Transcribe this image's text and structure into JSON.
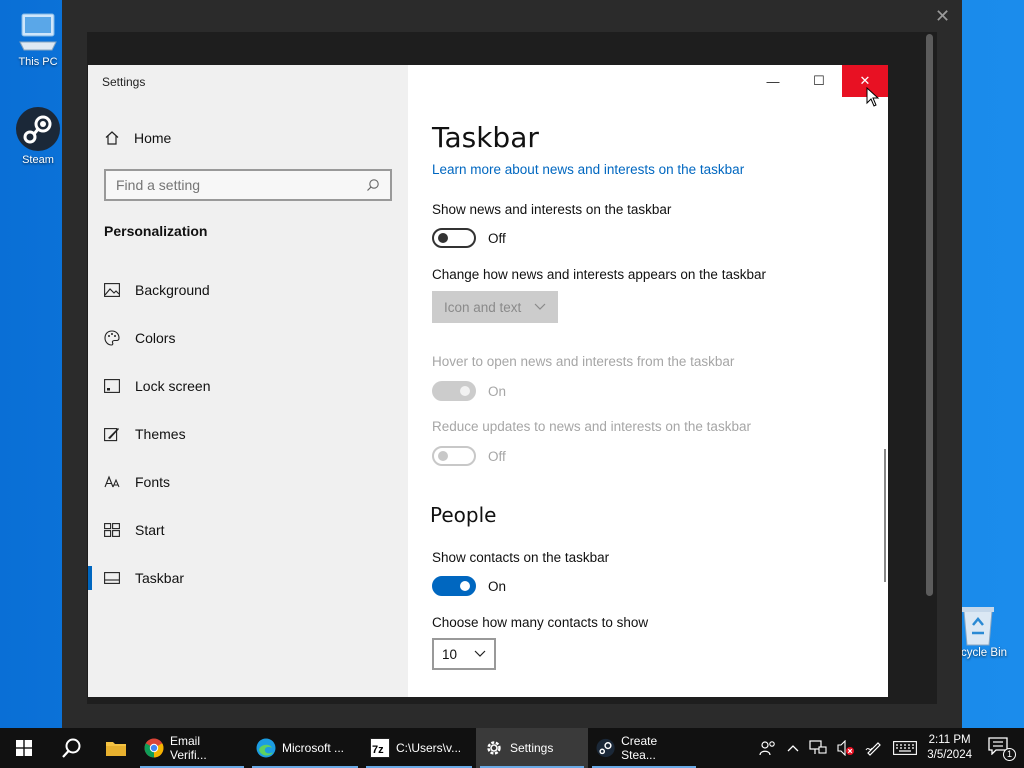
{
  "desktop": {
    "icons": [
      {
        "label": "This PC"
      },
      {
        "label": "Steam"
      }
    ],
    "recycle_bin_label": "cycle Bin"
  },
  "overlay": {
    "close_glyph": "✕"
  },
  "settings": {
    "app_title": "Settings",
    "home_label": "Home",
    "search_placeholder": "Find a setting",
    "section_heading": "Personalization",
    "nav": [
      {
        "label": "Background",
        "icon": "picture-icon"
      },
      {
        "label": "Colors",
        "icon": "palette-icon"
      },
      {
        "label": "Lock screen",
        "icon": "lock-screen-icon"
      },
      {
        "label": "Themes",
        "icon": "brush-icon"
      },
      {
        "label": "Fonts",
        "icon": "font-icon"
      },
      {
        "label": "Start",
        "icon": "start-icon"
      },
      {
        "label": "Taskbar",
        "icon": "taskbar-icon",
        "active": true
      }
    ],
    "title_buttons": {
      "minimize": "—",
      "maximize": "☐",
      "close": "✕"
    },
    "page_title": "Taskbar",
    "learn_more_link": "Learn more about news and interests on the taskbar",
    "show_news_label": "Show news and interests on the taskbar",
    "show_news_state": "Off",
    "change_appearance_label": "Change how news and interests appears on the taskbar",
    "appearance_value": "Icon and text",
    "hover_label": "Hover to open news and interests from the taskbar",
    "hover_state": "On",
    "reduce_label": "Reduce updates to news and interests on the taskbar",
    "reduce_state": "Off",
    "people_heading": "People",
    "show_contacts_label": "Show contacts on the taskbar",
    "show_contacts_state": "On",
    "contacts_count_label": "Choose how many contacts to show",
    "contacts_count_value": "10"
  },
  "taskbar": {
    "apps": [
      {
        "label": "Email Verifi...",
        "icon": "chrome-icon"
      },
      {
        "label": "Microsoft ...",
        "icon": "edge-icon"
      },
      {
        "label": "C:\\Users\\v...",
        "icon": "7zip-icon"
      },
      {
        "label": "Settings",
        "icon": "gear-icon",
        "active": true
      },
      {
        "label": "Create Stea...",
        "icon": "steam-icon"
      }
    ],
    "clock_time": "2:11 PM",
    "clock_date": "3/5/2024",
    "notification_count": "1"
  },
  "colors": {
    "accent": "#0067c0",
    "close_red": "#e81123",
    "desktop_blue": "#1280e0"
  }
}
